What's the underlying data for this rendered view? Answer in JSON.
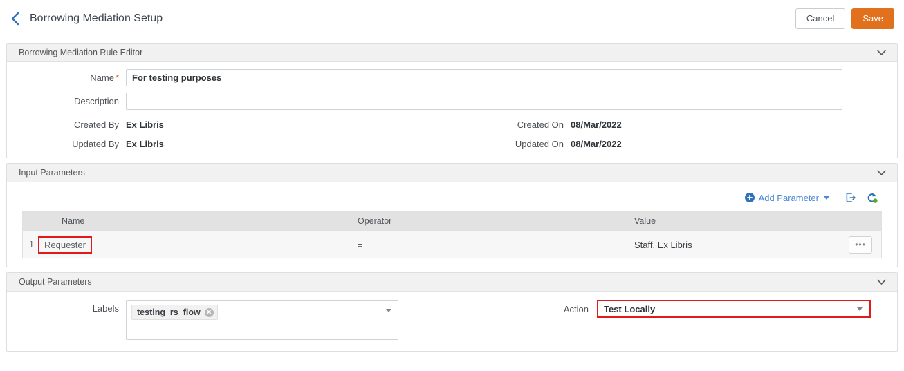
{
  "header": {
    "back_icon": "back-chevron-icon",
    "title": "Borrowing Mediation Setup",
    "cancel_label": "Cancel",
    "save_label": "Save",
    "save_color": "#e2711d"
  },
  "rule_editor": {
    "panel_title": "Borrowing Mediation Rule Editor",
    "collapse_icon": "chevron-down-icon",
    "name_label": "Name",
    "name_required_mark": "*",
    "name_value": "For testing purposes",
    "description_label": "Description",
    "description_value": "",
    "created_by_label": "Created By",
    "created_by_value": "Ex Libris",
    "created_on_label": "Created On",
    "created_on_value": "08/Mar/2022",
    "updated_by_label": "Updated By",
    "updated_by_value": "Ex Libris",
    "updated_on_label": "Updated On",
    "updated_on_value": "08/Mar/2022"
  },
  "input_parameters": {
    "panel_title": "Input Parameters",
    "collapse_icon": "chevron-down-icon",
    "add_parameter_label": "Add Parameter",
    "add_parameter_icon": "plus-circle-icon",
    "export_icon": "export-icon",
    "refresh_icon": "refresh-icon",
    "columns": [
      "Name",
      "Operator",
      "Value"
    ],
    "rows": [
      {
        "index": "1",
        "name": "Requester",
        "operator": "=",
        "value": "Staff, Ex Libris",
        "actions_label": "•••",
        "highlighted": true
      }
    ]
  },
  "output_parameters": {
    "panel_title": "Output Parameters",
    "collapse_icon": "chevron-down-icon",
    "labels_label": "Labels",
    "labels_chips": [
      "testing_rs_flow"
    ],
    "chip_remove_icon": "close-circle-icon",
    "action_label": "Action",
    "action_value": "Test Locally",
    "dropdown_icon": "caret-down-icon",
    "highlight_color": "#e01b1b"
  }
}
